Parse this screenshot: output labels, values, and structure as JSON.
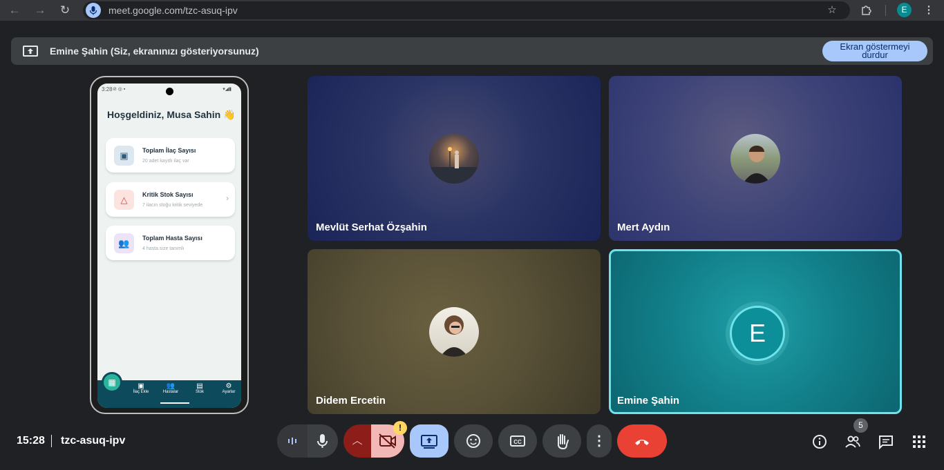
{
  "browser": {
    "url": "meet.google.com/tzc-asuq-ipv",
    "profile_initial": "E",
    "icons": [
      "back-arrow",
      "forward-arrow",
      "reload",
      "mic",
      "star",
      "extensions",
      "kebab-menu"
    ]
  },
  "banner": {
    "text": "Emine Şahin (Siz, ekranınızı gösteriyorsunuz)",
    "stop_label_line1": "Ekran göstermeyi",
    "stop_label_line2": "durdur"
  },
  "phone": {
    "status_time": "3:28",
    "greeting": "Hoşgeldiniz, Musa Sahin 👋",
    "cards": [
      {
        "title": "Toplam İlaç Sayısı",
        "subtitle": "20 adet kayıtlı ilaç var",
        "icon": "pill-box-icon",
        "color": "#dce7f0"
      },
      {
        "title": "Kritik Stok Sayısı",
        "subtitle": "7 ilacın stoğu kritik seviyede",
        "icon": "warning-icon",
        "color": "#fde3df"
      },
      {
        "title": "Toplam Hasta Sayısı",
        "subtitle": "4 hasta size tanımlı",
        "icon": "people-icon",
        "color": "#ece3f6"
      }
    ],
    "nav": [
      {
        "label": "İlaç Ekle",
        "icon": "add-box-icon"
      },
      {
        "label": "Hastalar",
        "icon": "people-icon"
      },
      {
        "label": "Stok",
        "icon": "archive-icon"
      },
      {
        "label": "Ayarlar",
        "icon": "gear-icon"
      }
    ]
  },
  "participants": [
    {
      "name": "Mevlüt Serhat Özşahin",
      "type": "photo"
    },
    {
      "name": "Mert Aydın",
      "type": "photo"
    },
    {
      "name": "Didem Ercetin",
      "type": "photo"
    },
    {
      "name": "Emine Şahin",
      "type": "letter",
      "initial": "E"
    }
  ],
  "footer": {
    "time": "15:28",
    "meeting_code": "tzc-asuq-ipv",
    "people_count": "5",
    "warning_glyph": "!"
  },
  "colors": {
    "end_call": "#e94235",
    "present_active": "#a8c7fa",
    "camera_off": "#f2b8b5",
    "camera_off_dark": "#8c1d18",
    "speaker_border": "#6fe3ec"
  }
}
